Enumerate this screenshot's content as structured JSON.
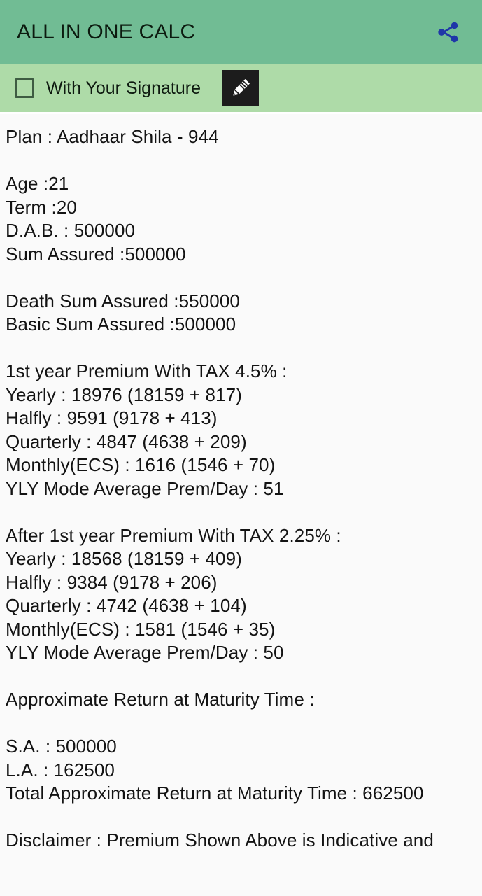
{
  "appbar": {
    "title": "ALL IN ONE CALC",
    "share_icon": "share-icon",
    "background_color": "#71bc94",
    "title_color": "#0c1a0f",
    "share_icon_color": "#1f37a8"
  },
  "signature_bar": {
    "checkbox_checked": false,
    "label": "With Your Signature",
    "signature_icon": "pencil-icon",
    "background_color": "#aedba8"
  },
  "report": {
    "lines": [
      "Plan : Aadhaar Shila - 944",
      "",
      "Age :21",
      "Term :20",
      "D.A.B. : 500000",
      "Sum Assured :500000",
      "",
      "Death Sum Assured :550000",
      "Basic Sum Assured :500000",
      "",
      "1st year Premium With TAX 4.5% :",
      "Yearly : 18976 (18159 + 817)",
      "Halfly : 9591 (9178 + 413)",
      "Quarterly : 4847 (4638 + 209)",
      "Monthly(ECS) : 1616 (1546 + 70)",
      "YLY Mode Average Prem/Day : 51",
      "",
      "After 1st year Premium With TAX 2.25% :",
      "Yearly : 18568 (18159 + 409)",
      "Halfly : 9384 (9178 + 206)",
      "Quarterly : 4742 (4638 + 104)",
      "Monthly(ECS) : 1581 (1546 + 35)",
      "YLY Mode Average Prem/Day : 50",
      "",
      "Approximate Return at Maturity Time :",
      "",
      "S.A. : 500000",
      "L.A. : 162500",
      "Total Approximate Return at Maturity Time : 662500",
      "",
      "Disclaimer : Premium Shown Above is Indicative and"
    ]
  }
}
